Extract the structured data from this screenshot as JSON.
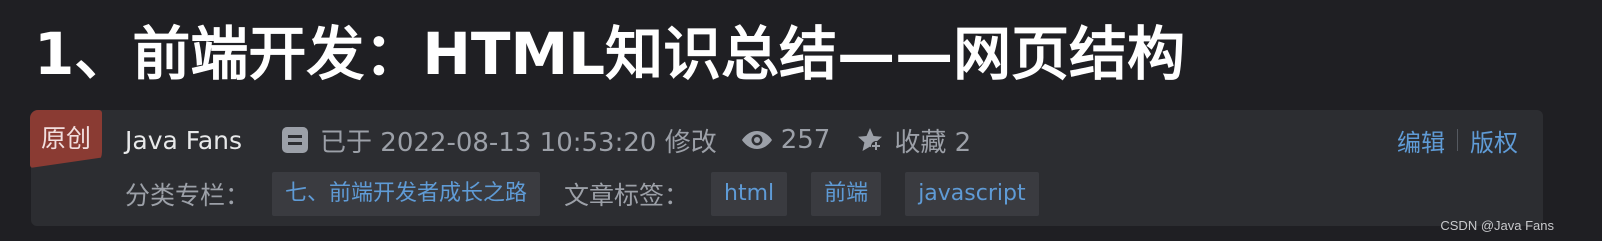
{
  "article": {
    "title": "1、前端开发：HTML知识总结——网页结构",
    "badge": "原创",
    "author": "Java Fans",
    "modified": "已于 2022-08-13 10:53:20 修改",
    "views": "257",
    "favorites": "收藏 2",
    "edit_label": "编辑",
    "copyright_label": "版权",
    "category_label": "分类专栏：",
    "category": "七、前端开发者成长之路",
    "tags_label": "文章标签：",
    "tags": [
      "html",
      "前端",
      "javascript"
    ]
  },
  "watermark": "CSDN @Java Fans",
  "colors": {
    "background": "#1f1f23",
    "card": "#2c2d31",
    "badge": "#8a3b33",
    "link": "#5f9bd6",
    "muted": "#9ca0a8"
  },
  "icons": [
    "edit-icon",
    "eye-icon",
    "star-icon"
  ]
}
